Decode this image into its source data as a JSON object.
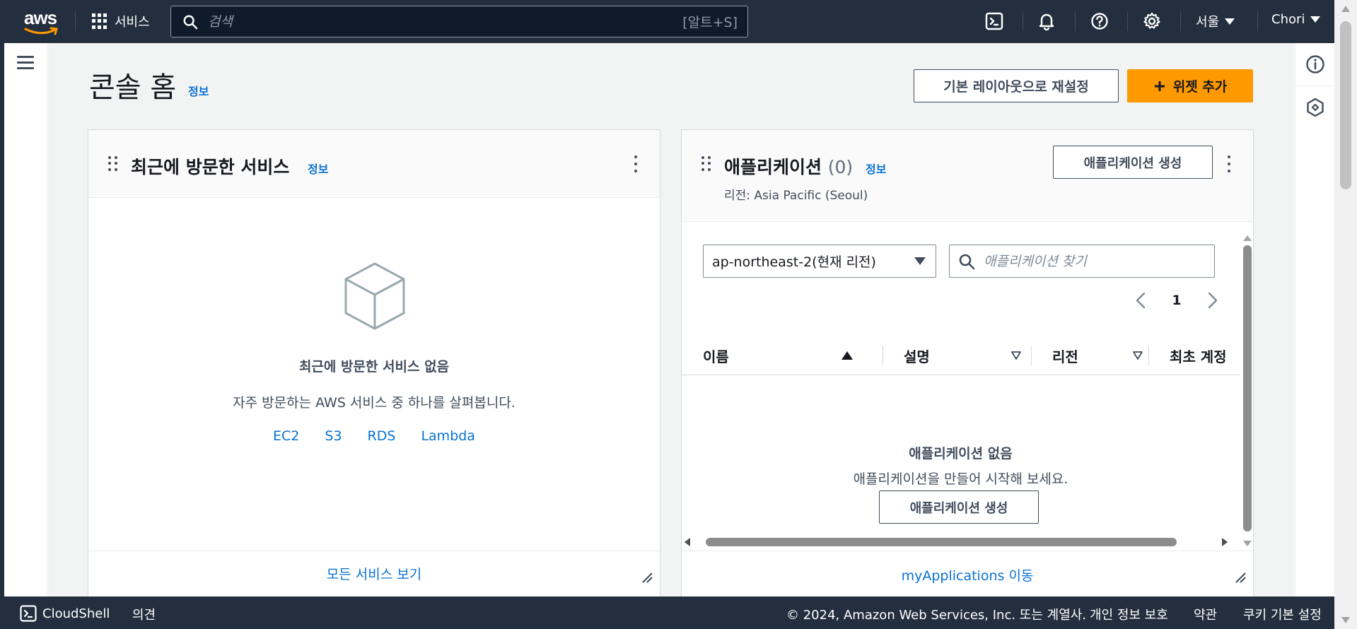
{
  "topbar": {
    "logo_text": "aws",
    "services_label": "서비스",
    "search_placeholder": "검색",
    "search_shortcut": "[알트+S]",
    "region_label": "서울",
    "account_label": "Chori"
  },
  "icons": {
    "cloudshell": "cloudshell-icon",
    "notifications": "bell-icon",
    "help": "help-icon",
    "settings": "gear-icon",
    "menu": "hamburger-icon",
    "info_panel": "info-icon",
    "app_panel": "hexagon-icon"
  },
  "page": {
    "title": "콘솔 홈",
    "info_label": "정보",
    "reset_button": "기본 레이아웃으로 재설정",
    "add_widget_button": "위젯 추가"
  },
  "recent_widget": {
    "title": "최근에 방문한 서비스",
    "info_label": "정보",
    "empty_title": "최근에 방문한 서비스 없음",
    "empty_desc": "자주 방문하는 AWS 서비스 중 하나를 살펴봅니다.",
    "links": [
      "EC2",
      "S3",
      "RDS",
      "Lambda"
    ],
    "footer_link": "모든 서비스 보기"
  },
  "apps_widget": {
    "title": "애플리케이션",
    "count": "(0)",
    "info_label": "정보",
    "create_button": "애플리케이션 생성",
    "region_line": "리전: Asia Pacific (Seoul)",
    "region_select": "ap-northeast-2(현재 리전)",
    "search_placeholder": "애플리케이션 찾기",
    "page_number": "1",
    "columns": [
      "이름",
      "설명",
      "리전",
      "최초 계정"
    ],
    "empty_title": "애플리케이션 없음",
    "empty_desc": "애플리케이션을 만들어 시작해 보세요.",
    "empty_create_button": "애플리케이션 생성",
    "footer_link": "myApplications 이동"
  },
  "statusbar": {
    "cloudshell_label": "CloudShell",
    "feedback_label": "의견",
    "copyright": "© 2024, Amazon Web Services, Inc. 또는 계열사.",
    "privacy": "개인 정보 보호",
    "terms": "약관",
    "cookies": "쿠키 기본 설정"
  },
  "colors": {
    "nav_bg": "#232f3e",
    "primary": "#ff9900",
    "link": "#0972d3",
    "page_bg": "#f2f3f3"
  }
}
